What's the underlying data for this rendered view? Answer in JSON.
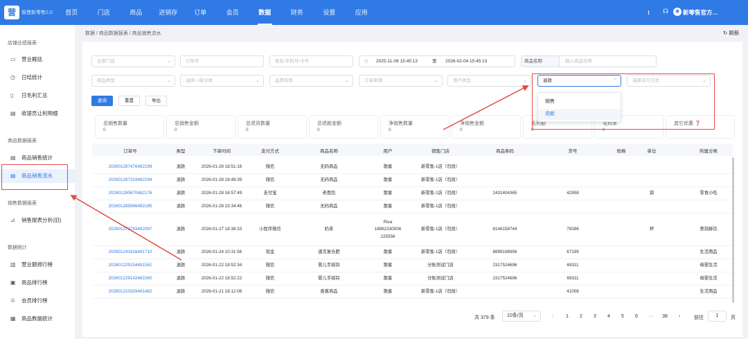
{
  "topbar": {
    "logo_char": "营",
    "brand": "智慧新零售2.0",
    "nav": [
      "首页",
      "门店",
      "商品",
      "进销存",
      "订单",
      "会员",
      "数据",
      "财务",
      "设置",
      "应用"
    ],
    "active_nav": "数据",
    "user": "新零售官方…"
  },
  "sidebar": {
    "groups": [
      "店铺业绩报表",
      "商品数据报表",
      "销售数据报表",
      "数据统计"
    ],
    "items": [
      "营业概括",
      "日结统计",
      "日毛利汇总",
      "收银员让利明细",
      "商品销售统计",
      "商品销售流水",
      "销售报表分析(旧)",
      "营业额排行榜",
      "商品排行榜",
      "会员排行榜",
      "商品数据统计"
    ],
    "active": "商品销售流水"
  },
  "breadcrumb": "数据 / 商品数据报表 / 商品销售流水",
  "refresh_label": "刷新",
  "filters": {
    "store": "全部门店",
    "order_no": "订单号",
    "member": "姓名/手机号/卡号",
    "date_start": "2025-11-06 15:45:13",
    "date_sep": "至",
    "date_end": "2026-02-04 15:45:13",
    "product_label": "商品名称",
    "product_placeholder": "输入商品名称",
    "product_type": "商品类型",
    "category": "选择一级分类",
    "brand": "品牌名称",
    "source": "订单来源",
    "user_type": "用户类型",
    "kind_value": "退款",
    "pay_method": "选择支付方式"
  },
  "buttons": {
    "query": "查询",
    "reset": "重置",
    "export": "导出"
  },
  "dropdown": {
    "options": [
      "销售",
      "退款"
    ],
    "selected": "退款"
  },
  "stats": [
    {
      "label": "总销售数量",
      "value": "0"
    },
    {
      "label": "总销售金额",
      "value": "0"
    },
    {
      "label": "总退货数量",
      "value": "0"
    },
    {
      "label": "总退款金额",
      "value": "0"
    },
    {
      "label": "净销售数量",
      "value": "0"
    },
    {
      "label": "净销售金额",
      "value": "0"
    },
    {
      "label": "毛利额",
      "value": "0"
    },
    {
      "label": "毛利率",
      "value": "0"
    },
    {
      "label": "其它优惠",
      "value": ""
    }
  ],
  "table": {
    "headers": [
      "订单号",
      "类型",
      "下单时间",
      "支付方式",
      "商品名称",
      "用户",
      "销售门店",
      "商品条码",
      "货号",
      "规格",
      "单位",
      "所属分类"
    ],
    "rows": [
      [
        "202601287476482199",
        "退款",
        "2026-01-28 18:51:16",
        "微信",
        "无码商品",
        [
          "散客"
        ],
        "新零售-1店（勿改）",
        "",
        "",
        "",
        "",
        ""
      ],
      [
        "202601287319482194",
        "退款",
        "2026-01-28 18:48:39",
        "微信",
        "无码商品",
        [
          "散客"
        ],
        "新零售-1店（勿改）",
        "",
        "",
        "",
        "",
        ""
      ],
      [
        "202601280670482176",
        "退款",
        "2026-01-28 16:57:49",
        "支付宝",
        "老面包",
        [
          "散客"
        ],
        "新零售-1店（勿改）",
        "2431404365",
        "42958",
        "",
        "袋",
        "零食小吃"
      ],
      [
        "202601285666482165",
        "退款",
        "2026-01-28 15:34:46",
        "微信",
        "无码商品",
        [
          "散客"
        ],
        "新零售-1店（勿改）",
        "",
        "",
        "",
        "",
        ""
      ],
      [
        "202601270783482097",
        "退款",
        "2026-01-27 18:38:33",
        "小程序微信",
        "奶茶",
        [
          "Riva",
          "18862330506",
          "225556"
        ],
        "新零售-1店（勿改）",
        "8146158744",
        "78396",
        "",
        "杯",
        "葱蒜酥饺"
      ],
      [
        "202601241916481710",
        "退款",
        "2026-01-24 10:31:56",
        "现金",
        "速冻复合肥",
        [
          "散客"
        ],
        "新零售-1店（勿改）",
        "8899198956",
        "67199",
        "",
        "",
        "生活用品"
      ],
      [
        "202601229154481561",
        "退款",
        "2026-01-22 18:52:34",
        "微信",
        "婴儿手摇铃",
        [
          "散客"
        ],
        "分账测试门店",
        "2317524696",
        "69311",
        "",
        "",
        "母婴生活"
      ],
      [
        "202601229142481560",
        "退款",
        "2026-01-22 18:52:22",
        "微信",
        "婴儿手摇铃",
        [
          "散客"
        ],
        "分账测试门店",
        "2317524696",
        "69311",
        "",
        "",
        "母婴生活"
      ],
      [
        "202601210329481482",
        "退款",
        "2026-01-21 18:12:08",
        "微信",
        "香蕉商品",
        [
          "散客"
        ],
        "新零售-1店（勿改）",
        "",
        "41008",
        "",
        "",
        "生活用品"
      ]
    ]
  },
  "pagination": {
    "total": "共 379 条",
    "page_size": "10条/页",
    "prev": "‹",
    "pages": [
      "1",
      "2",
      "3",
      "4",
      "5",
      "6",
      "···",
      "38"
    ],
    "active": "1",
    "next": "›",
    "goto": "前往",
    "goto_value": "1",
    "page_unit": "页"
  },
  "colors": {
    "primary": "#2f7ae5",
    "highlight": "#e04b47"
  }
}
